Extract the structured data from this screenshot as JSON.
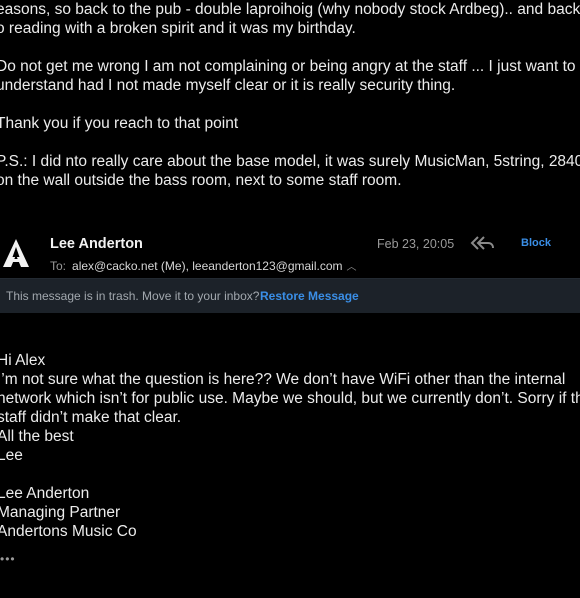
{
  "previous_message": {
    "lines": [
      "easons, so back to the pub - double laproihoig (why nobody stock Ardbeg).. and back",
      "o reading with a broken spirit and it was my birthday.",
      "",
      "Do not get me wrong I am not complaining or being angry at the staff ... I just want to",
      "understand had I not made myself clear or it is really security thing.",
      "",
      "Thank you if you reach to that point",
      "",
      "P.S.: I did nto really care about the base model, it was surely MusicMan, 5string, 2840",
      "on the wall outside the bass room, next to some staff room."
    ]
  },
  "message_header": {
    "sender": "Lee Anderton",
    "date": "Feb 23, 20:05",
    "reply_icon": "reply-all-icon",
    "block_label": "Block",
    "to_label": "To:",
    "recipients": "alex@cacko.net (Me), leeanderton123@gmail.com",
    "caret_icon": "chevron-up-icon"
  },
  "trash_notice": {
    "message": "This message is in trash. Move it to your inbox?",
    "action_label": "Restore Message"
  },
  "reply_message": {
    "lines": [
      "Hi Alex",
      "I’m not sure what the question is here?? We don’t have WiFi other than the internal",
      "network which isn’t for public use. Maybe we should, but we currently don’t. Sorry if the",
      "staff didn’t make that clear.",
      "All the best",
      "Lee",
      "",
      "Lee Anderton",
      "Managing Partner",
      "Andertons Music Co"
    ],
    "more_label": "•••"
  },
  "colors": {
    "background": "#000000",
    "accent": "#3a8ee6",
    "notice_bar": "#1c2229"
  }
}
